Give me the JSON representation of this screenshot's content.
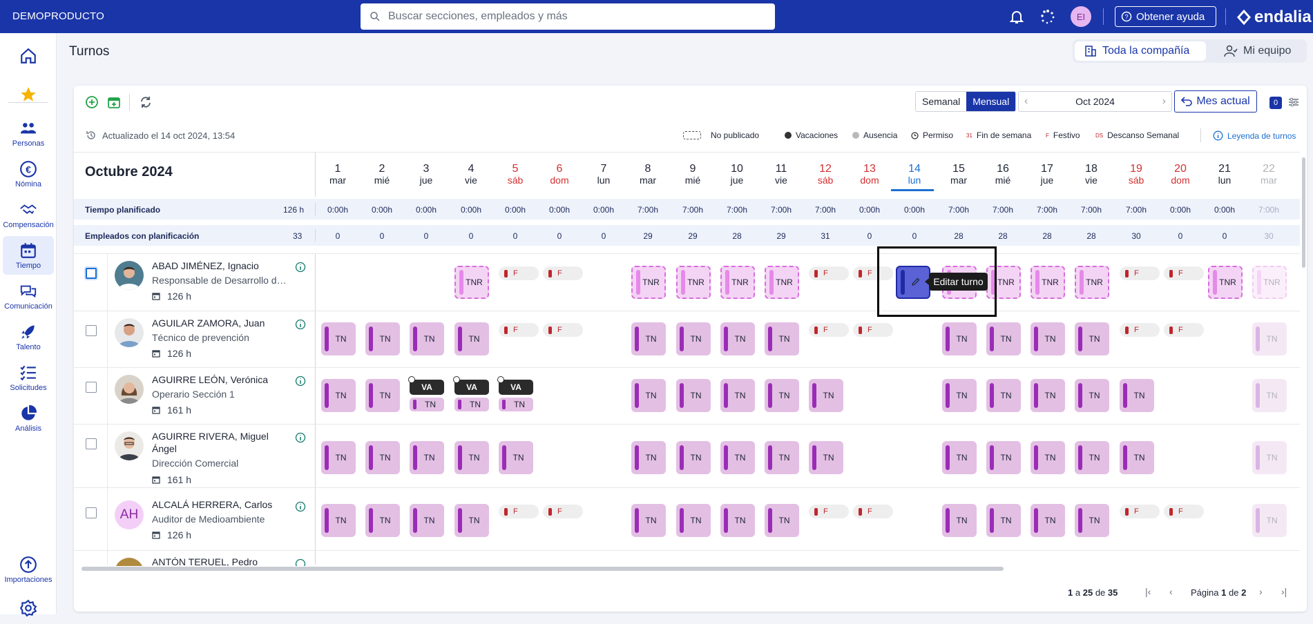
{
  "topbar": {
    "brand": "DEMOPRODUCTO",
    "search_placeholder": "Buscar secciones, empleados y más",
    "user_initials": "EI",
    "help_label": "Obtener ayuda",
    "logo_text": "endalia"
  },
  "sidebar": {
    "items": [
      {
        "label": "",
        "icon": "home-icon"
      },
      {
        "label": "",
        "icon": "star-icon"
      },
      {
        "label": "Personas",
        "icon": "people-icon"
      },
      {
        "label": "Nómina",
        "icon": "euro-icon"
      },
      {
        "label": "Compensación",
        "icon": "handshake-icon"
      },
      {
        "label": "Tiempo",
        "icon": "calendar-icon"
      },
      {
        "label": "Comunicación",
        "icon": "chat-icon"
      },
      {
        "label": "Talento",
        "icon": "rocket-icon"
      },
      {
        "label": "Solicitudes",
        "icon": "checklist-icon"
      },
      {
        "label": "Análisis",
        "icon": "pie-chart-icon"
      },
      {
        "label": "Importaciones",
        "icon": "upload-icon"
      },
      {
        "label": "",
        "icon": "gear-icon"
      }
    ]
  },
  "page": {
    "title": "Turnos",
    "scope_company": "Toda la compañía",
    "scope_team": "Mi equipo"
  },
  "toolbar": {
    "view_weekly": "Semanal",
    "view_monthly": "Mensual",
    "current_month": "Oct 2024",
    "today_button": "Mes actual",
    "filter_count": "0"
  },
  "status": {
    "updated": "Actualizado el 14 oct 2024, 13:54"
  },
  "legend": {
    "not_published": "No publicado",
    "vacations": "Vacaciones",
    "absence": "Ausencia",
    "permission": "Permiso",
    "weekend": "Fin de semana",
    "holiday": "Festivo",
    "weekly_rest": "Descanso Semanal",
    "weekend_mark": "31",
    "holiday_mark": "F",
    "rest_mark": "DS",
    "link": "Leyenda de turnos"
  },
  "grid": {
    "month_title": "Octubre 2024",
    "days": [
      {
        "n": "1",
        "w": "mar"
      },
      {
        "n": "2",
        "w": "mié"
      },
      {
        "n": "3",
        "w": "jue"
      },
      {
        "n": "4",
        "w": "vie"
      },
      {
        "n": "5",
        "w": "sáb"
      },
      {
        "n": "6",
        "w": "dom"
      },
      {
        "n": "7",
        "w": "lun"
      },
      {
        "n": "8",
        "w": "mar"
      },
      {
        "n": "9",
        "w": "mié"
      },
      {
        "n": "10",
        "w": "jue"
      },
      {
        "n": "11",
        "w": "vie"
      },
      {
        "n": "12",
        "w": "sáb"
      },
      {
        "n": "13",
        "w": "dom"
      },
      {
        "n": "14",
        "w": "lun"
      },
      {
        "n": "15",
        "w": "mar"
      },
      {
        "n": "16",
        "w": "mié"
      },
      {
        "n": "17",
        "w": "jue"
      },
      {
        "n": "18",
        "w": "vie"
      },
      {
        "n": "19",
        "w": "sáb"
      },
      {
        "n": "20",
        "w": "dom"
      },
      {
        "n": "21",
        "w": "lun"
      },
      {
        "n": "22",
        "w": "mar"
      }
    ],
    "planned_label": "Tiempo planificado",
    "planned_total": "126 h",
    "planned": [
      "0:00h",
      "0:00h",
      "0:00h",
      "0:00h",
      "0:00h",
      "0:00h",
      "0:00h",
      "7:00h",
      "7:00h",
      "7:00h",
      "7:00h",
      "7:00h",
      "0:00h",
      "0:00h",
      "7:00h",
      "7:00h",
      "7:00h",
      "7:00h",
      "7:00h",
      "0:00h",
      "0:00h",
      "7:00h"
    ],
    "employees_label": "Empleados con planificación",
    "employees_total": "33",
    "employees": [
      "0",
      "0",
      "0",
      "0",
      "0",
      "0",
      "0",
      "29",
      "29",
      "28",
      "29",
      "31",
      "0",
      "0",
      "28",
      "28",
      "28",
      "28",
      "30",
      "0",
      "0",
      "30"
    ]
  },
  "employees": [
    {
      "name": "ABAD JIMÉNEZ, Ignacio",
      "position": "Responsable de Desarrollo de Negocio",
      "hours": "126 h"
    },
    {
      "name": "AGUILAR ZAMORA, Juan",
      "position": "Técnico de prevención",
      "hours": "126 h"
    },
    {
      "name": "AGUIRRE LEÓN, Verónica",
      "position": "Operario Sección 1",
      "hours": "161 h"
    },
    {
      "name": "AGUIRRE RIVERA, Miguel Ángel",
      "position": "Dirección Comercial",
      "hours": "161 h"
    },
    {
      "name": "ALCALÁ HERRERA, Carlos",
      "position": "Auditor de Medioambiente",
      "hours": "126 h",
      "initials": "AH"
    },
    {
      "name": "ANTÓN TERUEL, Pedro",
      "position": "",
      "hours": ""
    }
  ],
  "shift_labels": {
    "tn": "TN",
    "tnr": "TNR",
    "festivo": "F",
    "vacaciones": "VA"
  },
  "tooltip": "Editar turno",
  "pagination": {
    "range_start": "1",
    "a": "a",
    "range_end": "25",
    "de": "de",
    "total": "35",
    "page_label": "Página",
    "page": "1",
    "of": "de",
    "pages": "2"
  },
  "colors": {
    "brand": "#1a35a8",
    "shift": "#e3bfe4",
    "shift_bar": "#9b2cb6",
    "holiday": "#c0262d",
    "weekend": "#d32f2f",
    "today": "#1a6fd1"
  }
}
